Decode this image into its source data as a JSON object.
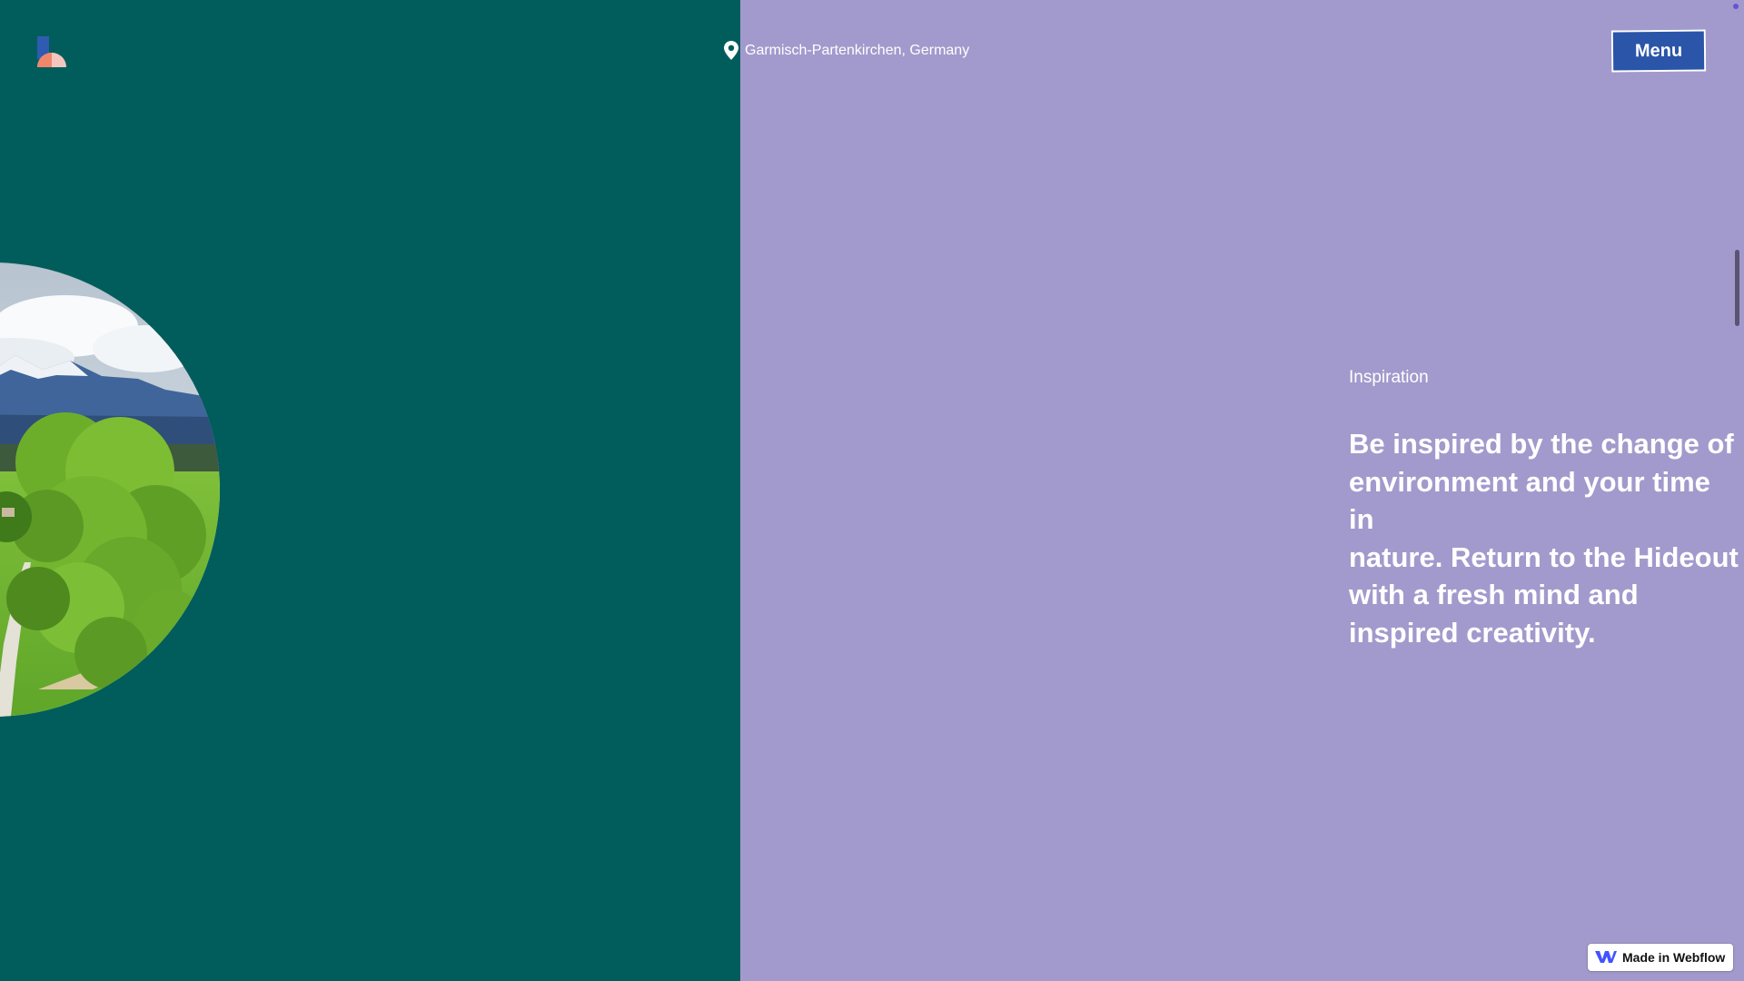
{
  "header": {
    "location": "Garmisch-Partenkirchen, Germany",
    "menu_label": "Menu"
  },
  "icons": {
    "logo": "brand-logo",
    "location": "map-pin-icon",
    "webflow": "webflow-logo-icon"
  },
  "section": {
    "label": "Inspiration",
    "text": "Be inspired by the change of\nenvironment and your time in\nnature. Return to the Hideout\nwith a fresh mind and\ninspired creativity."
  },
  "badge": {
    "label": "Made in Webflow"
  },
  "colors": {
    "left_panel": "#015d5c",
    "right_panel": "#a29acc",
    "menu_button": "#2a55a8",
    "logo_blue": "#2f5bb3",
    "logo_orange": "#f0876a",
    "logo_pink": "#f4c6c0"
  }
}
